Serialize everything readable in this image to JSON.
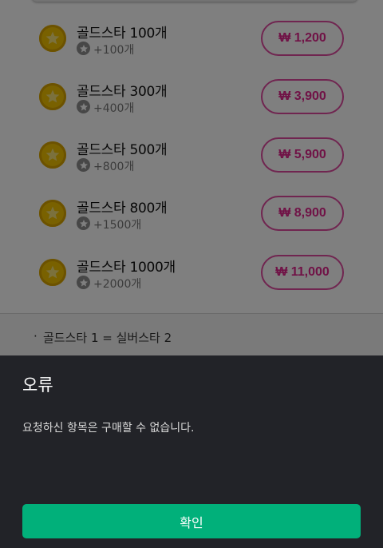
{
  "store": {
    "items": [
      {
        "name": "골드스타 100개",
        "bonus": "+100개",
        "price": "₩ 1,200"
      },
      {
        "name": "골드스타 300개",
        "bonus": "+400개",
        "price": "₩ 3,900"
      },
      {
        "name": "골드스타 500개",
        "bonus": "+800개",
        "price": "₩ 5,900"
      },
      {
        "name": "골드스타 800개",
        "bonus": "+1500개",
        "price": "₩ 8,900"
      },
      {
        "name": "골드스타 1000개",
        "bonus": "+2000개",
        "price": "₩ 11,000"
      }
    ],
    "note": "골드스타 1 = 실버스타 2"
  },
  "error_dialog": {
    "title": "오류",
    "message": "요청하신 항목은 구매할 수 없습니다.",
    "confirm_label": "확인"
  },
  "colors": {
    "accent_pink": "#e0248c",
    "confirm_green": "#01b07a",
    "sheet_bg": "#222328",
    "coin_gold": "#f2c200"
  },
  "icons": {
    "coin": "gold-star-coin-icon",
    "bonus": "silver-star-icon"
  }
}
